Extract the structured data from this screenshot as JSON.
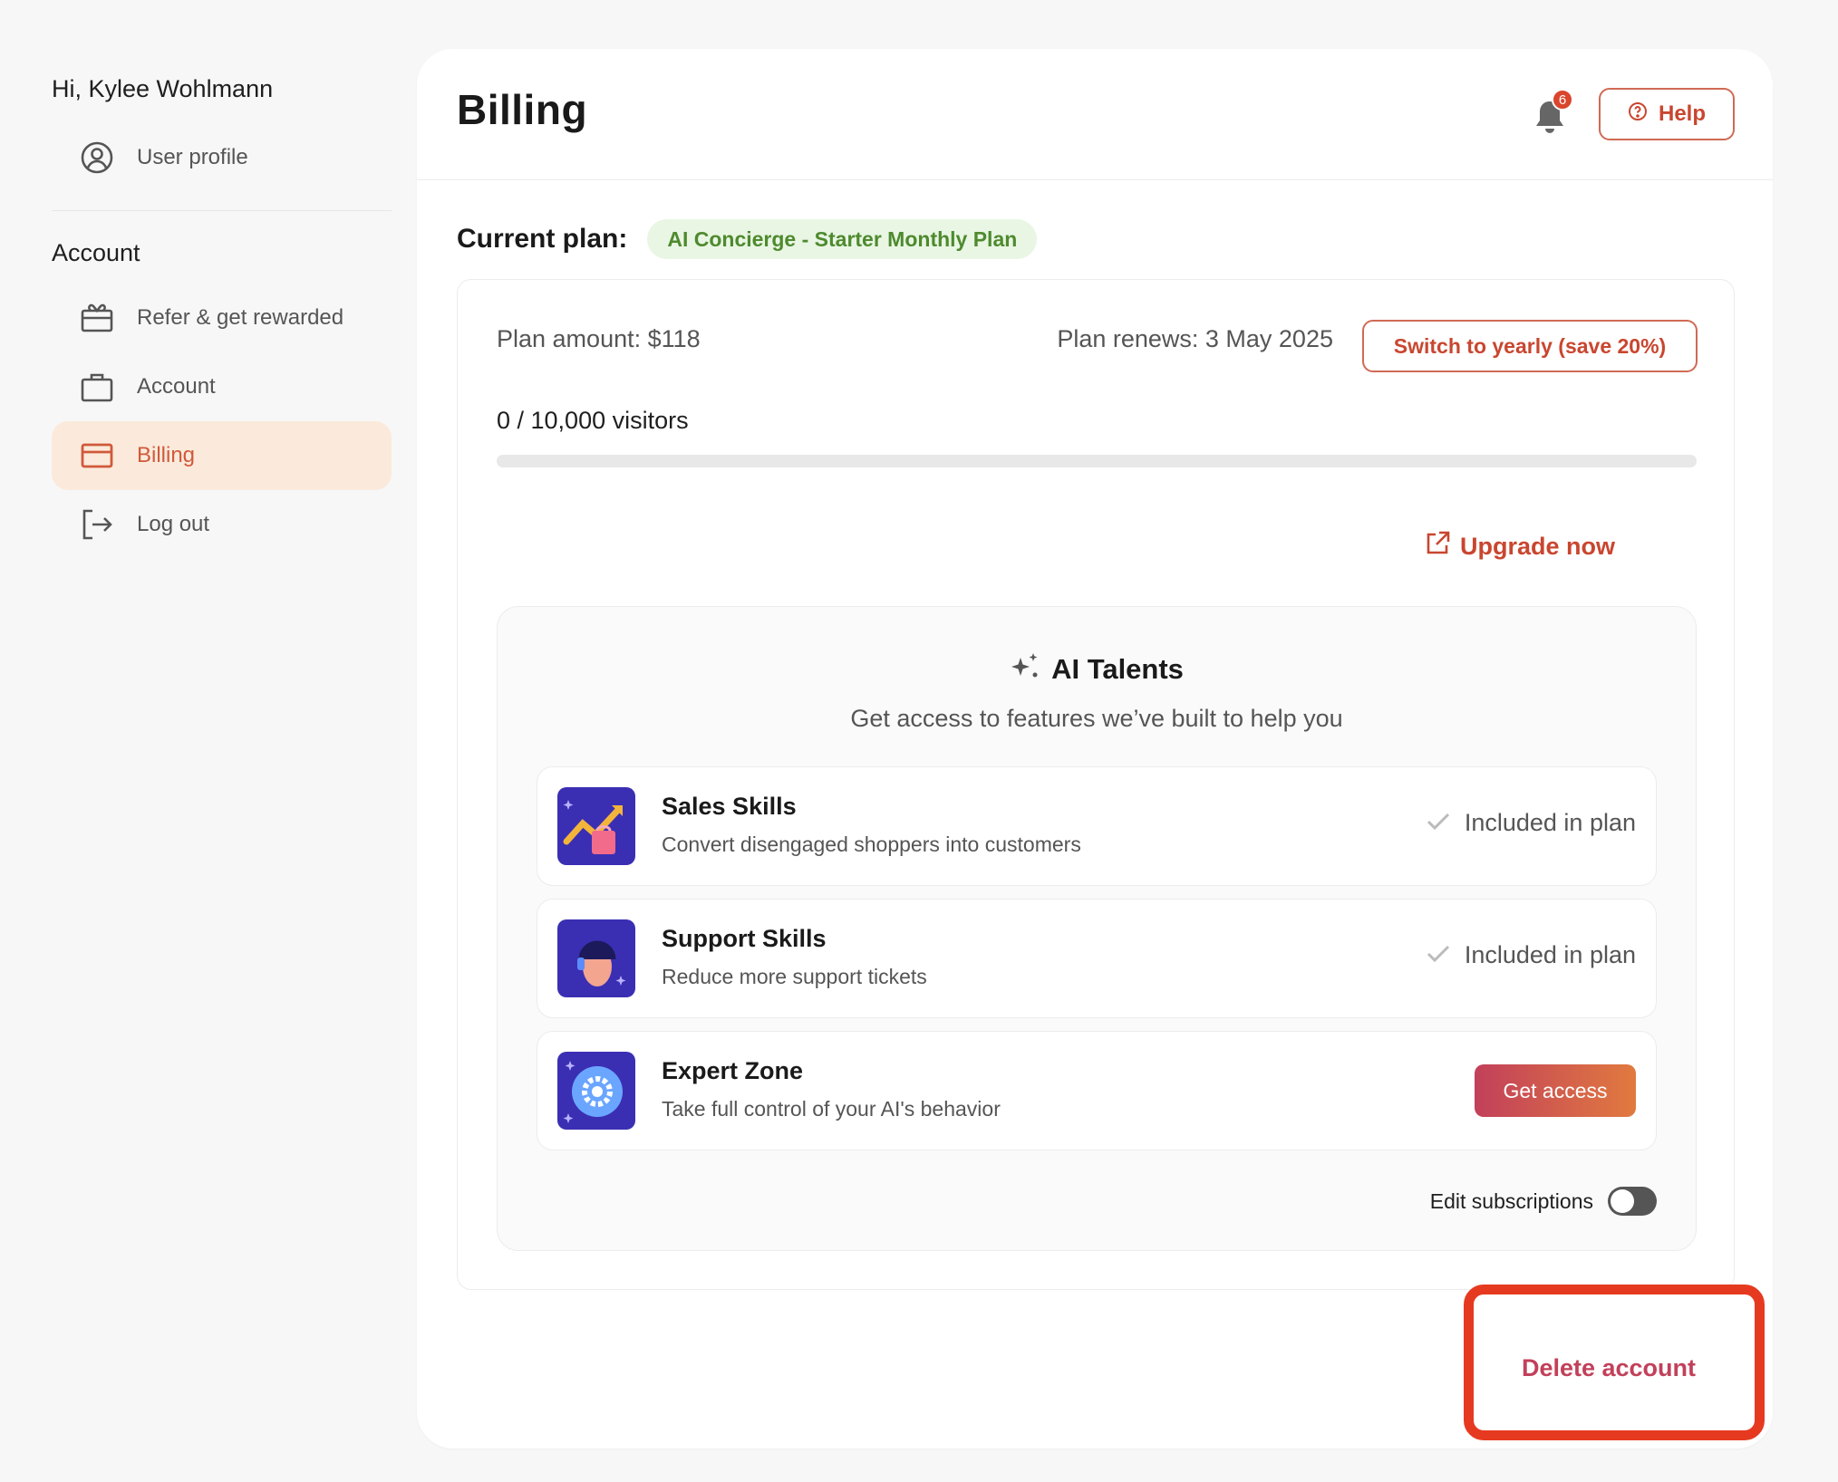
{
  "sidebar": {
    "greeting": "Hi, Kylee Wohlmann",
    "profile_item": {
      "label": "User profile",
      "icon": "user-circle-icon"
    },
    "section_label": "Account",
    "items": [
      {
        "label": "Refer & get rewarded",
        "icon": "gift-icon"
      },
      {
        "label": "Account",
        "icon": "briefcase-icon"
      },
      {
        "label": "Billing",
        "icon": "credit-card-icon",
        "active": true
      },
      {
        "label": "Log out",
        "icon": "logout-icon"
      }
    ]
  },
  "header": {
    "title": "Billing",
    "notification_count": "6",
    "help_label": "Help"
  },
  "plan": {
    "current_plan_label": "Current plan:",
    "plan_name": "AI Concierge - Starter Monthly Plan",
    "amount": "Plan amount: $118",
    "renews": "Plan renews: 3 May 2025",
    "switch_label": "Switch to yearly (save 20%)",
    "visitors": "0 / 10,000 visitors",
    "usage_fraction": 0,
    "upgrade_label": "Upgrade now"
  },
  "talents": {
    "title": "AI Talents",
    "subtitle": "Get access to features we’ve built to help you",
    "skills": [
      {
        "name": "Sales Skills",
        "desc": "Convert disengaged shoppers into customers",
        "status": "Included in plan"
      },
      {
        "name": "Support Skills",
        "desc": "Reduce more support tickets",
        "status": "Included in plan"
      },
      {
        "name": "Expert Zone",
        "desc": "Take full control of your AI's behavior",
        "action": "Get access"
      }
    ],
    "edit_label": "Edit subscriptions",
    "edit_enabled": false
  },
  "footer": {
    "delete_label": "Delete account"
  },
  "colors": {
    "accent": "#c9462f",
    "active_bg": "#fbeadb",
    "plan_pill_bg": "#e9f6e4",
    "plan_pill_text": "#4e8a2e",
    "highlight_frame": "#e63a20"
  }
}
